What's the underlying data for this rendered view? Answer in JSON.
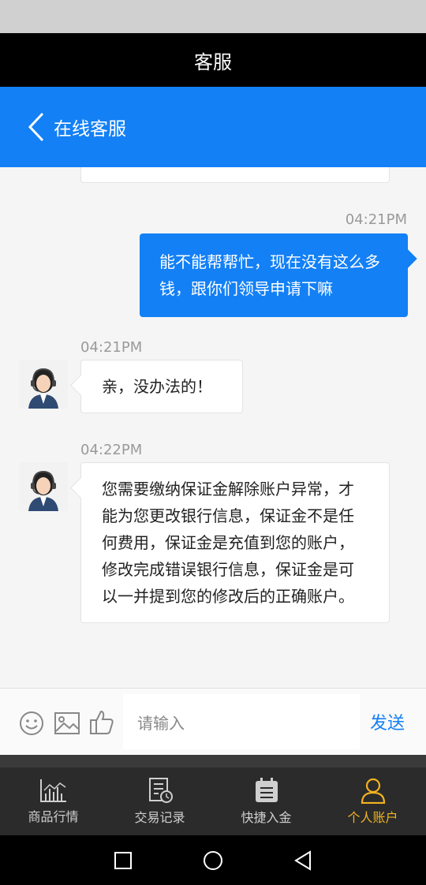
{
  "window": {
    "title": "客服"
  },
  "header": {
    "title": "在线客服"
  },
  "chat": {
    "messages": [
      {
        "sender": "user",
        "time": "04:21PM",
        "text": "能不能帮帮忙，现在没有这么多钱，跟你们领导申请下嘛"
      },
      {
        "sender": "agent",
        "time": "04:21PM",
        "text": "亲，没办法的！"
      },
      {
        "sender": "agent",
        "time": "04:22PM",
        "text": "您需要缴纳保证金解除账户异常，才能为您更改银行信息，保证金不是任何费用，保证金是充值到您的账户，修改完成错误银行信息，保证金是可以一并提到您的修改后的正确账户。"
      }
    ]
  },
  "input": {
    "placeholder": "请输入",
    "send_label": "发送"
  },
  "tabs": [
    {
      "label": "商品行情",
      "icon": "chart-icon",
      "active": false
    },
    {
      "label": "交易记录",
      "icon": "record-icon",
      "active": false
    },
    {
      "label": "快捷入金",
      "icon": "clipboard-icon",
      "active": false
    },
    {
      "label": "个人账户",
      "icon": "user-icon",
      "active": true
    }
  ],
  "colors": {
    "accent": "#1380f6",
    "active_tab": "#f2b320"
  }
}
